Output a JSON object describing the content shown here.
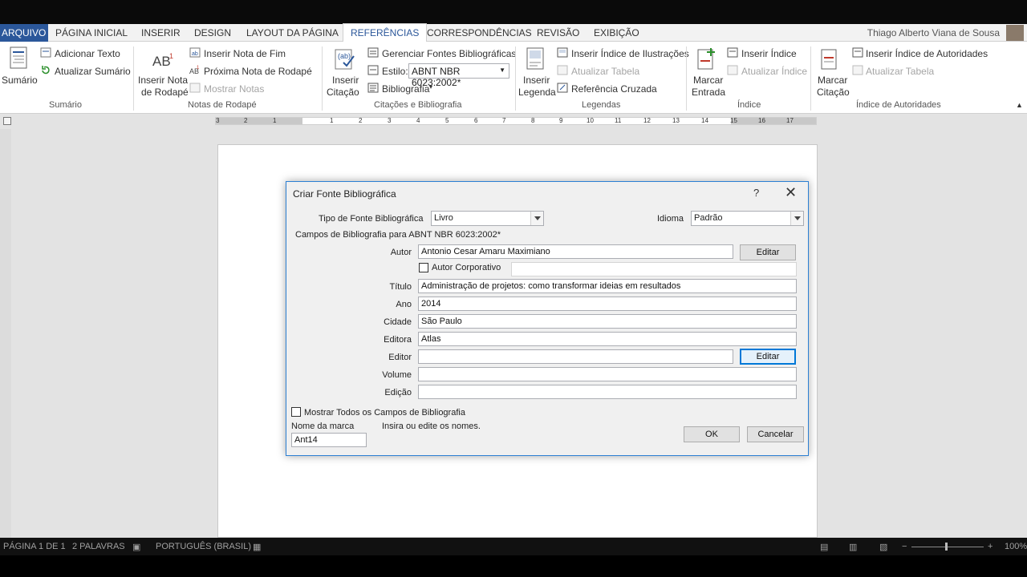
{
  "window": {
    "user": "Thiago Alberto Viana de Sousa"
  },
  "tabs": [
    "ARQUIVO",
    "PÁGINA INICIAL",
    "INSERIR",
    "DESIGN",
    "LAYOUT DA PÁGINA",
    "REFERÊNCIAS",
    "CORRESPONDÊNCIAS",
    "REVISÃO",
    "EXIBIÇÃO"
  ],
  "ribbon": {
    "sumario": {
      "label": "Sumário",
      "add_text": "Adicionar Texto",
      "update": "Atualizar Sumário",
      "group": "Sumário"
    },
    "notas": {
      "insert_footnote_1": "Inserir Nota",
      "insert_footnote_2": "de Rodapé",
      "insert_endnote": "Inserir Nota de Fim",
      "next_footnote": "Próxima Nota de Rodapé",
      "show_notes": "Mostrar Notas",
      "group": "Notas de Rodapé"
    },
    "citacoes": {
      "insert_citation_1": "Inserir",
      "insert_citation_2": "Citação",
      "manage_sources": "Gerenciar Fontes Bibliográficas",
      "style_label": "Estilo:",
      "style_value": "ABNT NBR 6023:2002*",
      "bibliography": "Bibliografia",
      "group": "Citações e Bibliografia"
    },
    "legendas": {
      "insert_caption_1": "Inserir",
      "insert_caption_2": "Legenda",
      "insert_figures": "Inserir Índice de Ilustrações",
      "update_table": "Atualizar Tabela",
      "cross_ref": "Referência Cruzada",
      "group": "Legendas"
    },
    "indice": {
      "mark_entry_1": "Marcar",
      "mark_entry_2": "Entrada",
      "insert_index": "Inserir Índice",
      "update_index": "Atualizar Índice",
      "group": "Índice"
    },
    "autoridades": {
      "mark_citation_1": "Marcar",
      "mark_citation_2": "Citação",
      "insert_authorities": "Inserir Índice de Autoridades",
      "update_table": "Atualizar Tabela",
      "group": "Índice de Autoridades"
    }
  },
  "ruler": {
    "ticks": [
      "3",
      "2",
      "1",
      "1",
      "2",
      "3",
      "4",
      "5",
      "6",
      "7",
      "8",
      "9",
      "10",
      "11",
      "12",
      "13",
      "14",
      "15",
      "16",
      "17"
    ]
  },
  "dialog": {
    "title": "Criar Fonte Bibliográfica",
    "help": "?",
    "close": "✕",
    "source_type_label": "Tipo de Fonte Bibliográfica",
    "source_type_value": "Livro",
    "language_label": "Idioma",
    "language_value": "Padrão",
    "fields_caption": "Campos de Bibliografia para ABNT NBR 6023:2002*",
    "author_label": "Autor",
    "author_value": "Antonio Cesar Amaru Maximiano",
    "edit_label": "Editar",
    "corporate_author_label": "Autor Corporativo",
    "title_label": "Título",
    "title_value": "Administração de projetos: como transformar ideias em resultados",
    "year_label": "Ano",
    "year_value": "2014",
    "city_label": "Cidade",
    "city_value": "São Paulo",
    "publisher_label": "Editora",
    "publisher_value": "Atlas",
    "editor_label": "Editor",
    "editor_value": "",
    "volume_label": "Volume",
    "volume_value": "",
    "edition_label": "Edição",
    "edition_value": "",
    "show_all_label": "Mostrar Todos os Campos de Bibliografia",
    "tag_label": "Nome da marca",
    "tag_value": "Ant14",
    "hint": "Insira ou edite os nomes.",
    "ok": "OK",
    "cancel": "Cancelar"
  },
  "status": {
    "page": "PÁGINA 1 DE 1",
    "words": "2 PALAVRAS",
    "language": "PORTUGUÊS (BRASIL)",
    "zoom": "100%"
  }
}
